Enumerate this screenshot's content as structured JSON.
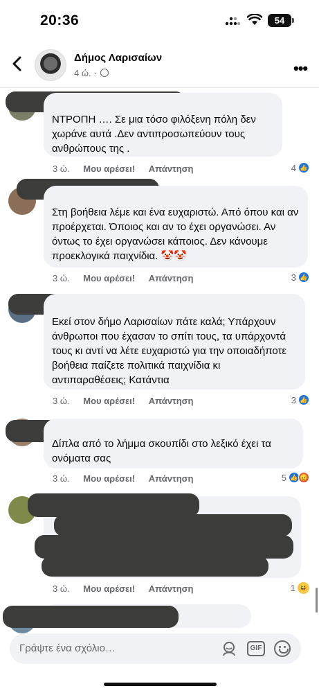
{
  "status_bar": {
    "time": "20:36",
    "battery": "54"
  },
  "header": {
    "page_name": "Δήμος Λαρισαίων",
    "post_age": "4 ώ. ·"
  },
  "comments": [
    {
      "text": "ΝΤΡΟΠΗ …. Σε μια τόσο φιλόξενη πόλη δεν χωράνε αυτά .Δεν αντιπροσωπεύουν τους ανθρώπους της .",
      "time": "3 ώ.",
      "like_label": "Μου αρέσει!",
      "reply_label": "Απάντηση",
      "reaction_count": "4"
    },
    {
      "text": "Στη βοήθεια λέμε και ένα ευχαριστώ. Από όπου και αν προέρχεται. Όποιος και αν το έχει οργανώσει. Αν όντως το έχει οργανώσει κάποιος. Δεν κάνουμε προεκλογικά παιχνίδια.",
      "emoji": "🤡🤡",
      "time": "3 ώ.",
      "like_label": "Μου αρέσει!",
      "reply_label": "Απάντηση",
      "reaction_count": "3"
    },
    {
      "text": "Εκεί στον δήμο Λαρισαίων πάτε καλά; Υπάρχουν άνθρωποι που έχασαν το σπίτι τους, τα υπάρχοντά τους κι αντί να λέτε ευχαριστώ για την οποιαδήποτε βοήθεια παίζετε πολιτικά παιχνίδια κι αντιπαραθέσεις; Κατάντια",
      "time": "3 ώ.",
      "like_label": "Μου αρέσει!",
      "reply_label": "Απάντηση",
      "reaction_count": "3"
    },
    {
      "text": "Δίπλα από το λήμμα σκουπίδι στο λεξικό έχει τα ονόματα σας",
      "time": "3 ώ.",
      "like_label": "Μου αρέσει!",
      "reply_label": "Απάντηση",
      "reaction_count": "5"
    },
    {
      "time": "3 ώ.",
      "like_label": "Μου αρέσει!",
      "reply_label": "Απάντηση",
      "reaction_count": "1"
    }
  ],
  "compose": {
    "placeholder": "Γράψτε ένα σχόλιο…",
    "gif_label": "GIF"
  },
  "icons": [
    "back-arrow-icon",
    "more-icon",
    "globe-icon",
    "like-icon",
    "angry-icon",
    "haha-icon",
    "avatar-sticker-icon",
    "gif-icon",
    "emoji-icon",
    "signal-icon",
    "wifi-icon"
  ],
  "colors": {
    "bubble": "#f0f2f5",
    "secondary_text": "#65676b",
    "like_blue": "#1b74e4",
    "redaction": "#3c3d3a"
  }
}
